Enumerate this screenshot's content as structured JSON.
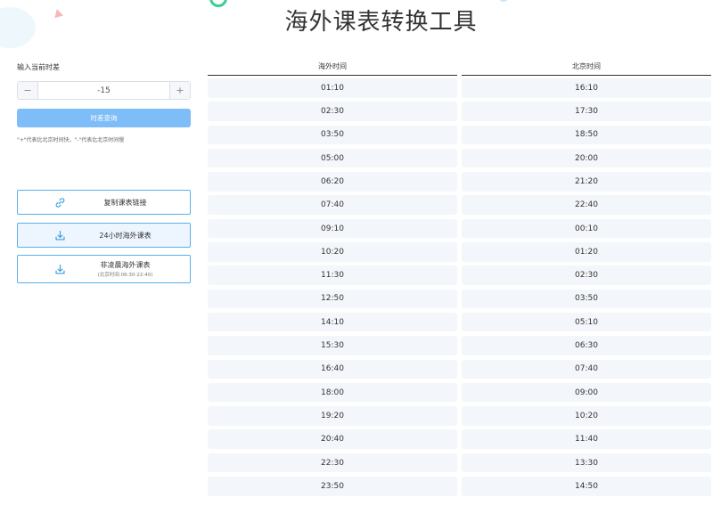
{
  "title": "海外课表转换工具",
  "left": {
    "offset_label": "输入当前时差",
    "stepper": {
      "minus": "−",
      "value": "-15",
      "plus": "+"
    },
    "query_button": "时差查询",
    "hint": "\"+\"代表比北京时间快，\"-\"代表比北京时间慢",
    "actions": {
      "copy_link": "复制课表链接",
      "download_24h": "24小时海外课表",
      "download_night": "非凌晨海外课表",
      "download_night_sub": "(北京时间:06:30-22:40)"
    }
  },
  "table": {
    "headers": {
      "overseas": "海外时间",
      "beijing": "北京时间"
    },
    "rows": [
      {
        "overseas": "01:10",
        "beijing": "16:10"
      },
      {
        "overseas": "02:30",
        "beijing": "17:30"
      },
      {
        "overseas": "03:50",
        "beijing": "18:50"
      },
      {
        "overseas": "05:00",
        "beijing": "20:00"
      },
      {
        "overseas": "06:20",
        "beijing": "21:20"
      },
      {
        "overseas": "07:40",
        "beijing": "22:40"
      },
      {
        "overseas": "09:10",
        "beijing": "00:10"
      },
      {
        "overseas": "10:20",
        "beijing": "01:20"
      },
      {
        "overseas": "11:30",
        "beijing": "02:30"
      },
      {
        "overseas": "12:50",
        "beijing": "03:50"
      },
      {
        "overseas": "14:10",
        "beijing": "05:10"
      },
      {
        "overseas": "15:30",
        "beijing": "06:30"
      },
      {
        "overseas": "16:40",
        "beijing": "07:40"
      },
      {
        "overseas": "18:00",
        "beijing": "09:00"
      },
      {
        "overseas": "19:20",
        "beijing": "10:20"
      },
      {
        "overseas": "20:40",
        "beijing": "11:40"
      },
      {
        "overseas": "22:30",
        "beijing": "13:30"
      },
      {
        "overseas": "23:50",
        "beijing": "14:50"
      }
    ]
  },
  "colors": {
    "accent": "#7fbdf8",
    "border": "#5ab0e6",
    "cell_bg": "#f3f6fa",
    "icon": "#3b9be0"
  },
  "icons": {
    "copy": "link-icon",
    "download": "download-icon"
  }
}
